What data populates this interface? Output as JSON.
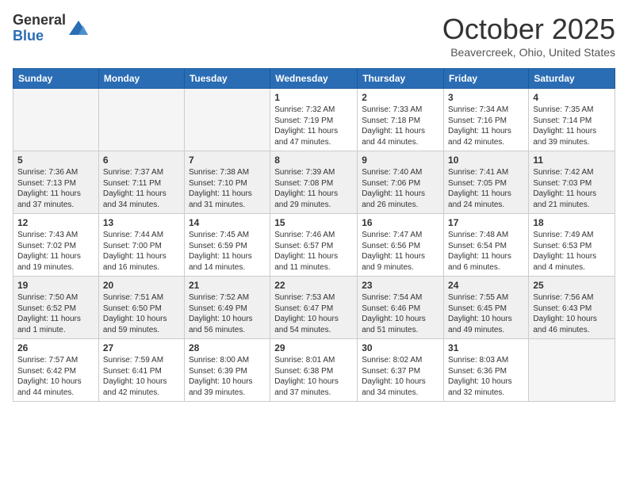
{
  "header": {
    "logo_general": "General",
    "logo_blue": "Blue",
    "month_title": "October 2025",
    "location": "Beavercreek, Ohio, United States"
  },
  "days_of_week": [
    "Sunday",
    "Monday",
    "Tuesday",
    "Wednesday",
    "Thursday",
    "Friday",
    "Saturday"
  ],
  "weeks": [
    [
      {
        "num": "",
        "info": ""
      },
      {
        "num": "",
        "info": ""
      },
      {
        "num": "",
        "info": ""
      },
      {
        "num": "1",
        "info": "Sunrise: 7:32 AM\nSunset: 7:19 PM\nDaylight: 11 hours and 47 minutes."
      },
      {
        "num": "2",
        "info": "Sunrise: 7:33 AM\nSunset: 7:18 PM\nDaylight: 11 hours and 44 minutes."
      },
      {
        "num": "3",
        "info": "Sunrise: 7:34 AM\nSunset: 7:16 PM\nDaylight: 11 hours and 42 minutes."
      },
      {
        "num": "4",
        "info": "Sunrise: 7:35 AM\nSunset: 7:14 PM\nDaylight: 11 hours and 39 minutes."
      }
    ],
    [
      {
        "num": "5",
        "info": "Sunrise: 7:36 AM\nSunset: 7:13 PM\nDaylight: 11 hours and 37 minutes."
      },
      {
        "num": "6",
        "info": "Sunrise: 7:37 AM\nSunset: 7:11 PM\nDaylight: 11 hours and 34 minutes."
      },
      {
        "num": "7",
        "info": "Sunrise: 7:38 AM\nSunset: 7:10 PM\nDaylight: 11 hours and 31 minutes."
      },
      {
        "num": "8",
        "info": "Sunrise: 7:39 AM\nSunset: 7:08 PM\nDaylight: 11 hours and 29 minutes."
      },
      {
        "num": "9",
        "info": "Sunrise: 7:40 AM\nSunset: 7:06 PM\nDaylight: 11 hours and 26 minutes."
      },
      {
        "num": "10",
        "info": "Sunrise: 7:41 AM\nSunset: 7:05 PM\nDaylight: 11 hours and 24 minutes."
      },
      {
        "num": "11",
        "info": "Sunrise: 7:42 AM\nSunset: 7:03 PM\nDaylight: 11 hours and 21 minutes."
      }
    ],
    [
      {
        "num": "12",
        "info": "Sunrise: 7:43 AM\nSunset: 7:02 PM\nDaylight: 11 hours and 19 minutes."
      },
      {
        "num": "13",
        "info": "Sunrise: 7:44 AM\nSunset: 7:00 PM\nDaylight: 11 hours and 16 minutes."
      },
      {
        "num": "14",
        "info": "Sunrise: 7:45 AM\nSunset: 6:59 PM\nDaylight: 11 hours and 14 minutes."
      },
      {
        "num": "15",
        "info": "Sunrise: 7:46 AM\nSunset: 6:57 PM\nDaylight: 11 hours and 11 minutes."
      },
      {
        "num": "16",
        "info": "Sunrise: 7:47 AM\nSunset: 6:56 PM\nDaylight: 11 hours and 9 minutes."
      },
      {
        "num": "17",
        "info": "Sunrise: 7:48 AM\nSunset: 6:54 PM\nDaylight: 11 hours and 6 minutes."
      },
      {
        "num": "18",
        "info": "Sunrise: 7:49 AM\nSunset: 6:53 PM\nDaylight: 11 hours and 4 minutes."
      }
    ],
    [
      {
        "num": "19",
        "info": "Sunrise: 7:50 AM\nSunset: 6:52 PM\nDaylight: 11 hours and 1 minute."
      },
      {
        "num": "20",
        "info": "Sunrise: 7:51 AM\nSunset: 6:50 PM\nDaylight: 10 hours and 59 minutes."
      },
      {
        "num": "21",
        "info": "Sunrise: 7:52 AM\nSunset: 6:49 PM\nDaylight: 10 hours and 56 minutes."
      },
      {
        "num": "22",
        "info": "Sunrise: 7:53 AM\nSunset: 6:47 PM\nDaylight: 10 hours and 54 minutes."
      },
      {
        "num": "23",
        "info": "Sunrise: 7:54 AM\nSunset: 6:46 PM\nDaylight: 10 hours and 51 minutes."
      },
      {
        "num": "24",
        "info": "Sunrise: 7:55 AM\nSunset: 6:45 PM\nDaylight: 10 hours and 49 minutes."
      },
      {
        "num": "25",
        "info": "Sunrise: 7:56 AM\nSunset: 6:43 PM\nDaylight: 10 hours and 46 minutes."
      }
    ],
    [
      {
        "num": "26",
        "info": "Sunrise: 7:57 AM\nSunset: 6:42 PM\nDaylight: 10 hours and 44 minutes."
      },
      {
        "num": "27",
        "info": "Sunrise: 7:59 AM\nSunset: 6:41 PM\nDaylight: 10 hours and 42 minutes."
      },
      {
        "num": "28",
        "info": "Sunrise: 8:00 AM\nSunset: 6:39 PM\nDaylight: 10 hours and 39 minutes."
      },
      {
        "num": "29",
        "info": "Sunrise: 8:01 AM\nSunset: 6:38 PM\nDaylight: 10 hours and 37 minutes."
      },
      {
        "num": "30",
        "info": "Sunrise: 8:02 AM\nSunset: 6:37 PM\nDaylight: 10 hours and 34 minutes."
      },
      {
        "num": "31",
        "info": "Sunrise: 8:03 AM\nSunset: 6:36 PM\nDaylight: 10 hours and 32 minutes."
      },
      {
        "num": "",
        "info": ""
      }
    ]
  ]
}
